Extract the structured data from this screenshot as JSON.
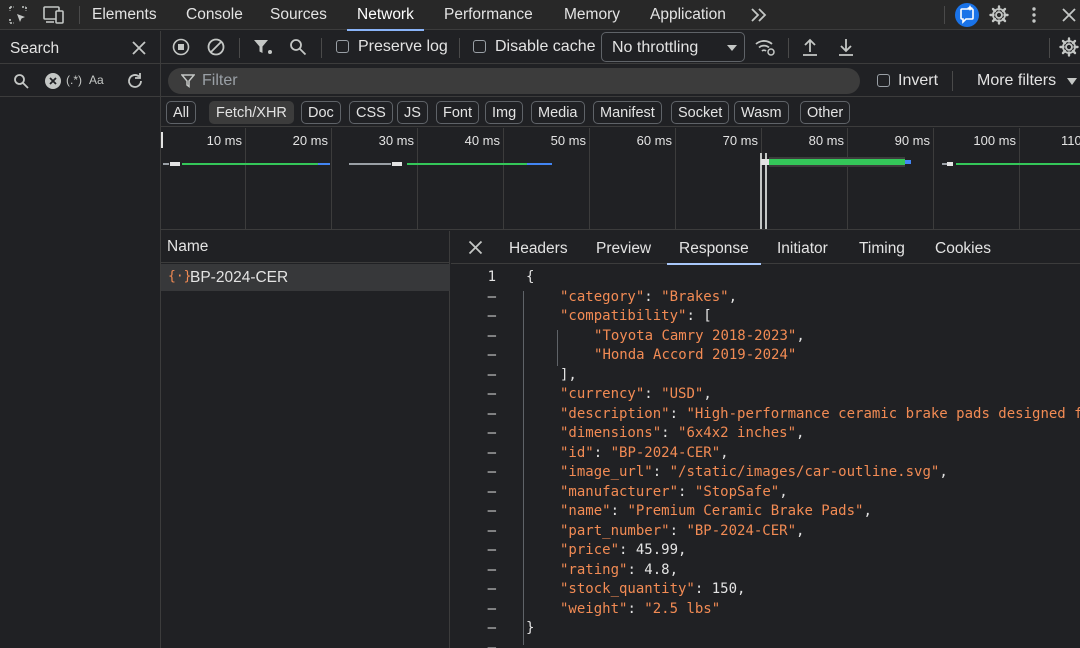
{
  "topbar": {
    "tabs": [
      "Elements",
      "Console",
      "Sources",
      "Network",
      "Performance",
      "Memory",
      "Application"
    ],
    "active_tab": "Network",
    "icons": [
      "inspect-element-icon",
      "device-toolbar-icon",
      "more-tabs-icon",
      "ai-assistance-icon",
      "settings-icon",
      "more-vert-icon",
      "close-icon"
    ]
  },
  "search_panel": {
    "title": "Search",
    "regex_label": "(.*)",
    "case_label": "Aa"
  },
  "toolbar": {
    "preserve_log": "Preserve log",
    "disable_cache": "Disable cache",
    "throttling": "No throttling"
  },
  "filter": {
    "placeholder": "Filter",
    "invert": "Invert",
    "more_filters": "More filters"
  },
  "type_chips": [
    "All",
    "Fetch/XHR",
    "Doc",
    "CSS",
    "JS",
    "Font",
    "Img",
    "Media",
    "Manifest",
    "Socket",
    "Wasm",
    "Other"
  ],
  "selected_chip": "Fetch/XHR",
  "timeline": {
    "ticks": [
      "10 ms",
      "20 ms",
      "30 ms",
      "40 ms",
      "50 ms",
      "60 ms",
      "70 ms",
      "80 ms",
      "90 ms",
      "100 ms",
      "110"
    ]
  },
  "requests": {
    "column_name": "Name",
    "items": [
      "BP-2024-CER"
    ]
  },
  "detail": {
    "tabs": [
      "Headers",
      "Preview",
      "Response",
      "Initiator",
      "Timing",
      "Cookies"
    ],
    "active_tab": "Response",
    "line_numbers": [
      "1",
      "–",
      "–",
      "–",
      "–",
      "–",
      "–",
      "–",
      "–",
      "–",
      "–",
      "–",
      "–",
      "–",
      "–",
      "–",
      "–",
      "–",
      "–",
      "–"
    ]
  },
  "response": {
    "category": "Brakes",
    "compatibility": [
      "Toyota Camry 2018-2023",
      "Honda Accord 2019-2024"
    ],
    "currency": "USD",
    "description": "High-performance ceramic brake pads designed f",
    "dimensions": "6x4x2 inches",
    "id": "BP-2024-CER",
    "image_url": "/static/images/car-outline.svg",
    "manufacturer": "StopSafe",
    "name": "Premium Ceramic Brake Pads",
    "part_number": "BP-2024-CER",
    "price": "45.99",
    "rating": "4.8",
    "stock_quantity": "150",
    "weight": "2.5 lbs"
  },
  "colors": {
    "accent": "#8ab4f8",
    "string": "#f28b54",
    "waterfall_green": "#34c759",
    "waterfall_blue": "#4285f4"
  }
}
